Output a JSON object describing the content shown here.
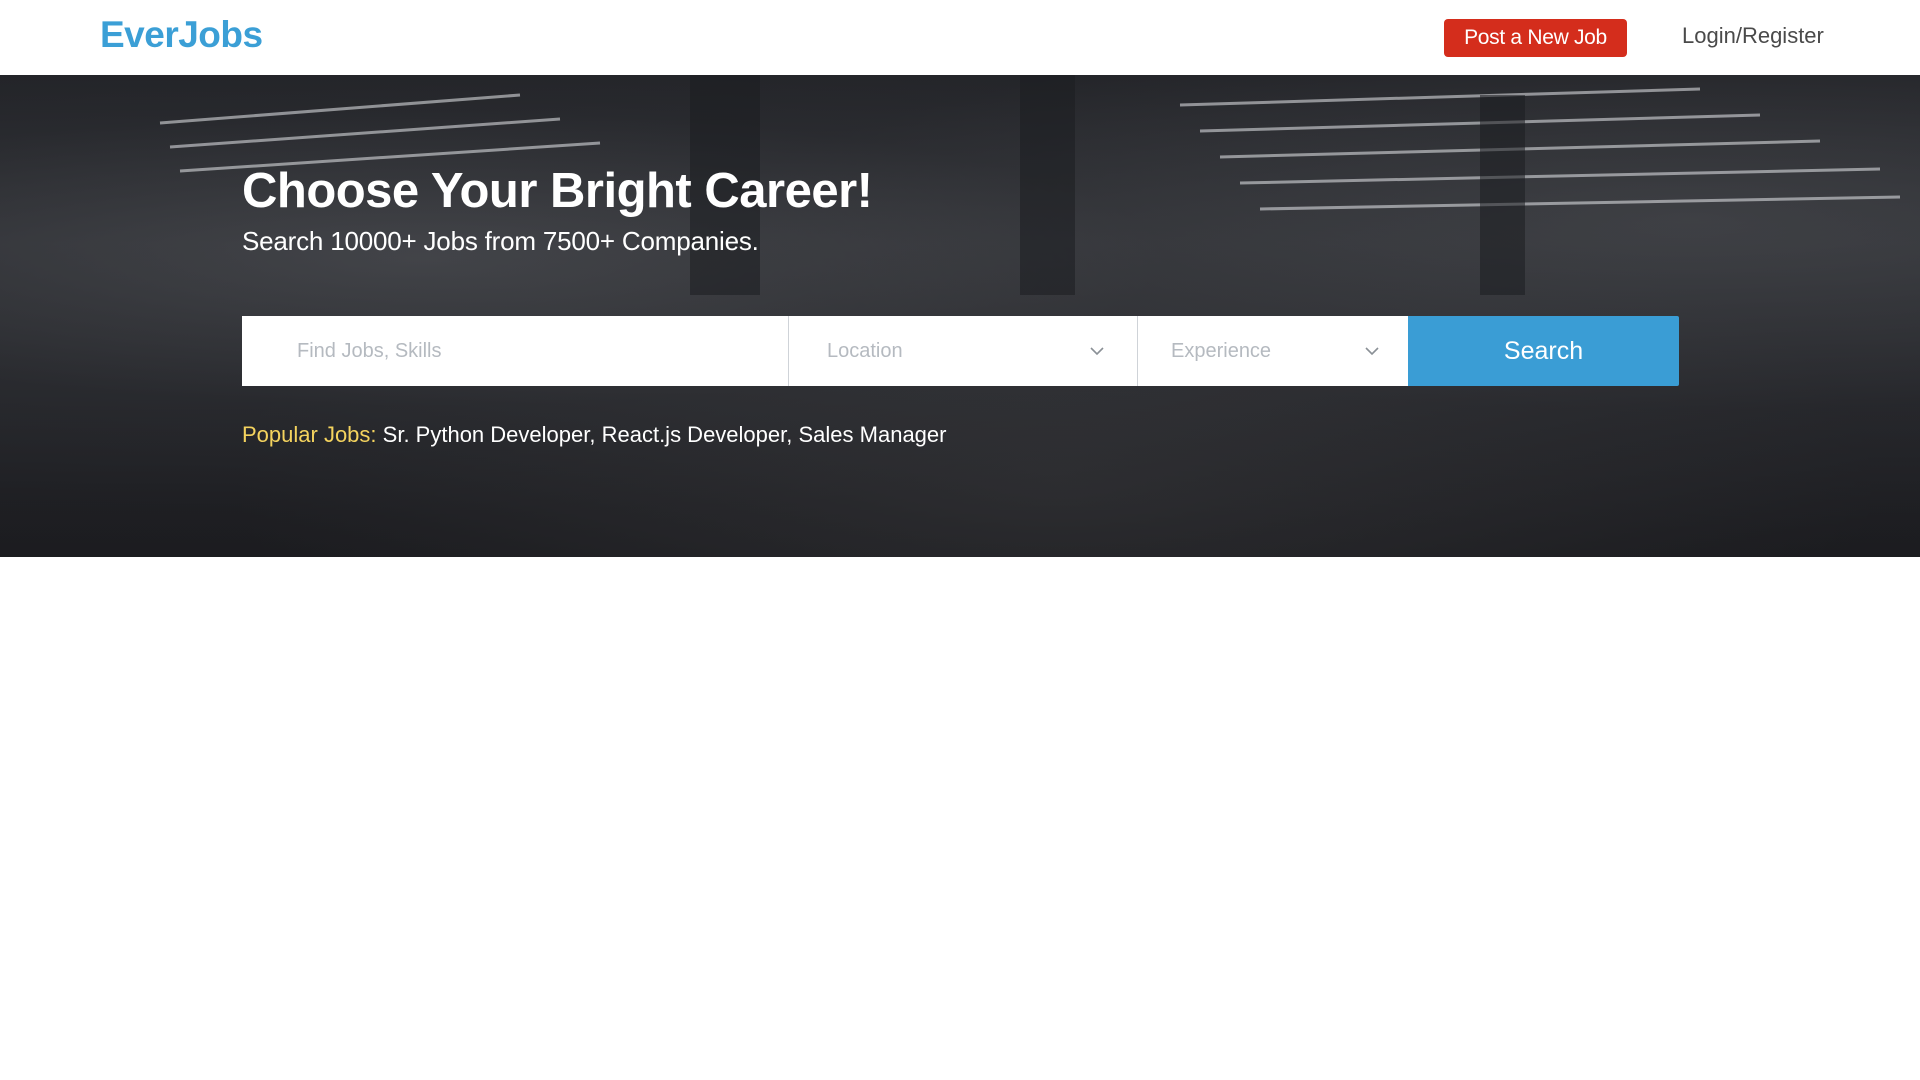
{
  "navbar": {
    "logo": "EverJobs",
    "post_job_label": "Post a New Job",
    "login_label": "Login/Register"
  },
  "hero": {
    "title": "Choose Your Bright Career!",
    "subtitle": "Search 10000+ Jobs from 7500+ Companies.",
    "search": {
      "keyword_placeholder": "Find Jobs, Skills",
      "location_label": "Location",
      "experience_label": "Experience",
      "search_button": "Search"
    },
    "popular": {
      "label": "Popular Jobs:",
      "items": [
        "Sr. Python Developer",
        "React.js Developer",
        "Sales Manager"
      ],
      "separator": ","
    }
  },
  "colors": {
    "brand": "#3b9fd6",
    "post_job": "#d42d1c",
    "search_button": "#3a9dd5",
    "popular_label": "#f4d35e"
  }
}
